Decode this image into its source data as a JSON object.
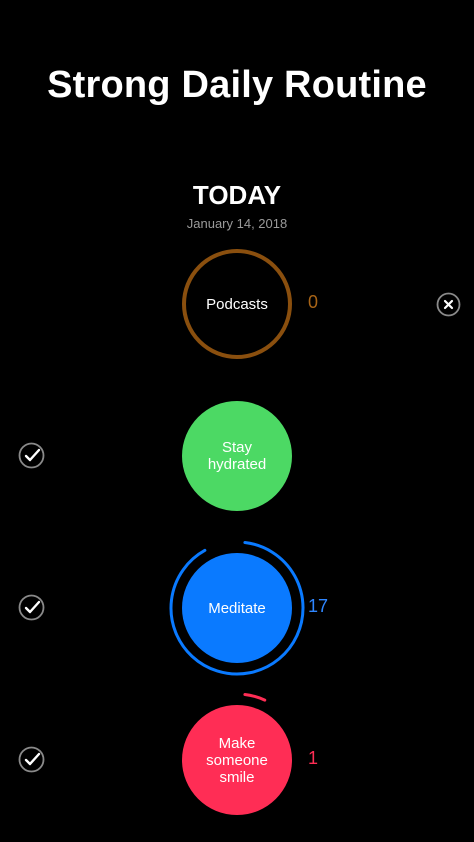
{
  "header": {
    "title": "Strong Daily Routine"
  },
  "day": {
    "label": "TODAY",
    "date": "January 14, 2018"
  },
  "habits": [
    {
      "name": "Podcasts",
      "count": "0",
      "color": "#8a4f0e",
      "count_color": "#a86416",
      "style": "outline",
      "progress": 0,
      "completed": false,
      "action_icon": "remove-icon"
    },
    {
      "name": "Stay hydrated",
      "count": "",
      "color": "#4cd964",
      "count_color": "#4cd964",
      "style": "filled",
      "progress": 0,
      "completed": true,
      "action_icon": "check-icon"
    },
    {
      "name": "Meditate",
      "count": "17",
      "color": "#0a7aff",
      "count_color": "#2f86ff",
      "style": "filled",
      "progress": 0.9,
      "completed": true,
      "action_icon": "check-icon"
    },
    {
      "name": "Make someone smile",
      "count": "1",
      "color": "#ff2d55",
      "count_color": "#ff2d55",
      "style": "filled",
      "progress": 0.05,
      "completed": true,
      "action_icon": "check-icon"
    }
  ]
}
